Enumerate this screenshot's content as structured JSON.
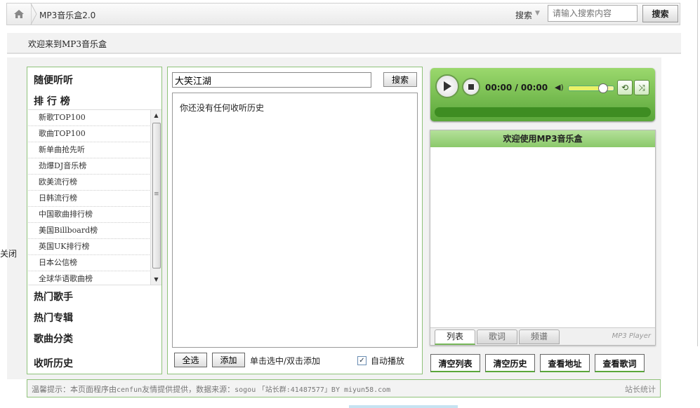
{
  "topbar": {
    "app_title": "MP3音乐盒2.0",
    "search_label": "搜索",
    "search_placeholder": "请输入搜索内容",
    "search_button": "搜索"
  },
  "welcome": "欢迎来到MP3音乐盒",
  "side_toggle": "关闭",
  "left_panel": {
    "random": "随便听听",
    "charts_title": "排 行 榜",
    "charts": [
      "新歌TOP100",
      "歌曲TOP100",
      "新单曲抢先听",
      "劲爆DJ音乐榜",
      "欧美流行榜",
      "日韩流行榜",
      "中国歌曲排行榜",
      "美国Billboard榜",
      "英国UK排行榜",
      "日本公信榜",
      "全球华语歌曲榜"
    ],
    "hot_singers": "热门歌手",
    "hot_albums": "热门专辑",
    "categories": "歌曲分类",
    "history": "收听历史"
  },
  "middle_panel": {
    "query": "大笑江湖",
    "search_button": "搜索",
    "empty_history": "你还没有任何收听历史",
    "select_all": "全选",
    "add": "添加",
    "hint": "单击选中/双击添加",
    "autoplay": "自动播放",
    "autoplay_checked": true
  },
  "player": {
    "time": "00:00 / 00:00",
    "volume_level": 0.75,
    "progress": 0
  },
  "list_panel": {
    "title": "欢迎使用MP3音乐盒",
    "tabs": [
      "列表",
      "歌词",
      "频谱"
    ],
    "brand": "MP3 Player"
  },
  "actions": [
    "清空列表",
    "清空历史",
    "查看地址",
    "查看歌词"
  ],
  "footer": {
    "prefix": "温馨提示：本页面程序由",
    "author": "cenfun",
    "mid": "友情提供提供，数据来源：",
    "source": "sogou",
    "group": "「站长群:41487577」BY miyun58.com",
    "stats": "站长统计"
  },
  "colors": {
    "accent": "#8fc27a",
    "player_green": "#5aa63a"
  }
}
